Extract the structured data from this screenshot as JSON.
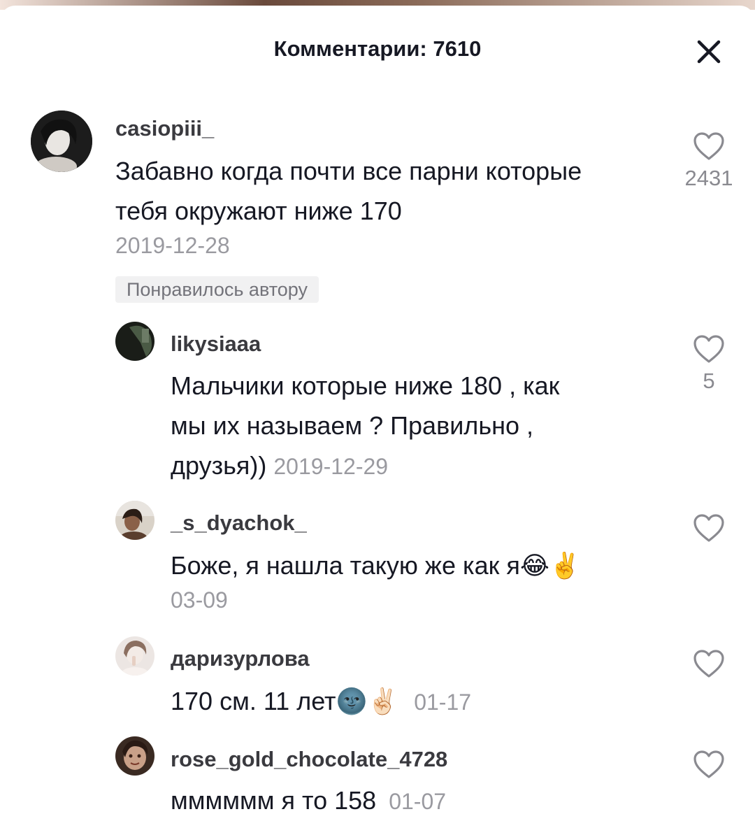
{
  "header": {
    "title": "Комментарии: 7610"
  },
  "comments": [
    {
      "username": "casiopiii_",
      "text": "Забавно когда почти все парни которые тебя окружают ниже 170",
      "date": "2019-12-28",
      "badge": "Понравилось автору",
      "likes": "2431",
      "avatar_color": "#2a2a2a"
    },
    {
      "username": "likysiaaa",
      "text_line1": "Мальчики которые ниже 180 , как",
      "text_line2": "мы их называем ? Правильно ,",
      "text_line3": "друзья))",
      "date": "2019-12-29",
      "likes": "5",
      "avatar_color": "#33402f"
    },
    {
      "username": "_s_dyachok_",
      "text": "Боже, я нашла такую же как я😂✌️",
      "date": "03-09",
      "avatar_color": "#5b4636"
    },
    {
      "username": "даризурлова",
      "text": "170 см. 11 лет🌚✌🏻",
      "date": "01-17",
      "avatar_color": "#e8dcd6"
    },
    {
      "username": "rose_gold_chocolate_4728",
      "text": "мммммм я то 158",
      "date": "01-07",
      "avatar_color": "#6b4a3a"
    }
  ]
}
